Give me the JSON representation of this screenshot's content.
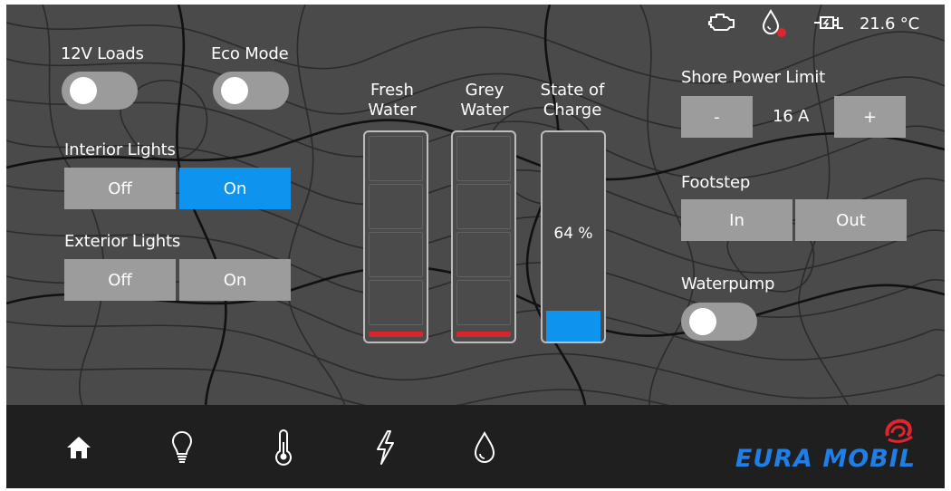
{
  "status": {
    "temperature": "21.6 °C",
    "icons": [
      "engine-icon",
      "water-drop-alert-icon",
      "shore-plug-icon"
    ],
    "alert_color": "#e0262c"
  },
  "loads": {
    "label": "12V Loads",
    "on": false
  },
  "eco": {
    "label": "Eco Mode",
    "on": false
  },
  "interior_lights": {
    "label": "Interior Lights",
    "off_label": "Off",
    "on_label": "On",
    "selected": "On"
  },
  "exterior_lights": {
    "label": "Exterior Lights",
    "off_label": "Off",
    "on_label": "On",
    "selected": "none"
  },
  "tanks": {
    "fresh": {
      "line1": "Fresh",
      "line2": "Water",
      "level": "low"
    },
    "grey": {
      "line1": "Grey",
      "line2": "Water",
      "level": "low"
    },
    "charge": {
      "line1": "State of",
      "line2": "Charge",
      "value_text": "64 %",
      "value": 64
    }
  },
  "shore_power": {
    "label": "Shore Power Limit",
    "minus_label": "-",
    "value": "16 A",
    "plus_label": "+"
  },
  "footstep": {
    "label": "Footstep",
    "in_label": "In",
    "out_label": "Out"
  },
  "waterpump": {
    "label": "Waterpump",
    "on": false
  },
  "nav": [
    "home-icon",
    "light-bulb-icon",
    "thermometer-icon",
    "lightning-icon",
    "water-drop-icon"
  ],
  "brand": {
    "name": "EURA MOBIL",
    "color": "#1f7fe6",
    "logo_color": "#e0262c"
  },
  "colors": {
    "accent": "#0e93ee",
    "button": "#9c9c9c",
    "background": "#4a4a4a",
    "navbar": "#1f1f1f"
  }
}
